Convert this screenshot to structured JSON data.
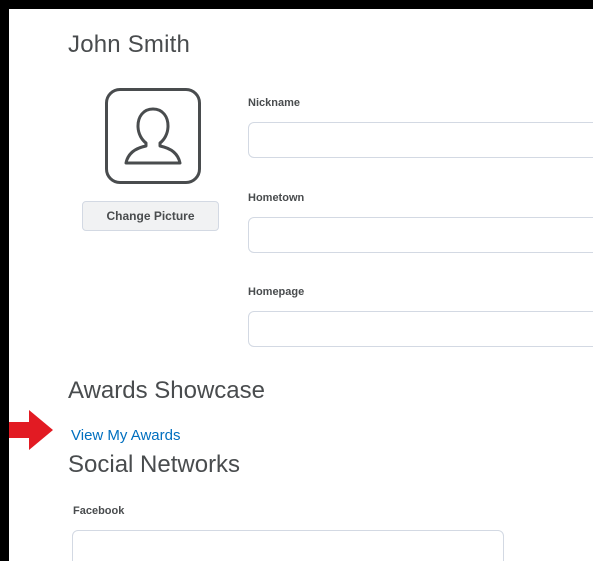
{
  "profile": {
    "name": "John Smith",
    "change_picture_label": "Change Picture"
  },
  "fields": {
    "nickname": {
      "label": "Nickname",
      "value": ""
    },
    "hometown": {
      "label": "Hometown",
      "value": ""
    },
    "homepage": {
      "label": "Homepage",
      "value": ""
    }
  },
  "awards": {
    "heading": "Awards Showcase",
    "link_label": "View My Awards"
  },
  "social": {
    "heading": "Social Networks",
    "facebook_label": "Facebook",
    "facebook_value": ""
  },
  "icons": {
    "avatar": "user-avatar-icon",
    "pointer": "red-arrow-icon"
  },
  "colors": {
    "link": "#006fbf",
    "arrow": "#e21b23",
    "text": "#494c4e"
  }
}
